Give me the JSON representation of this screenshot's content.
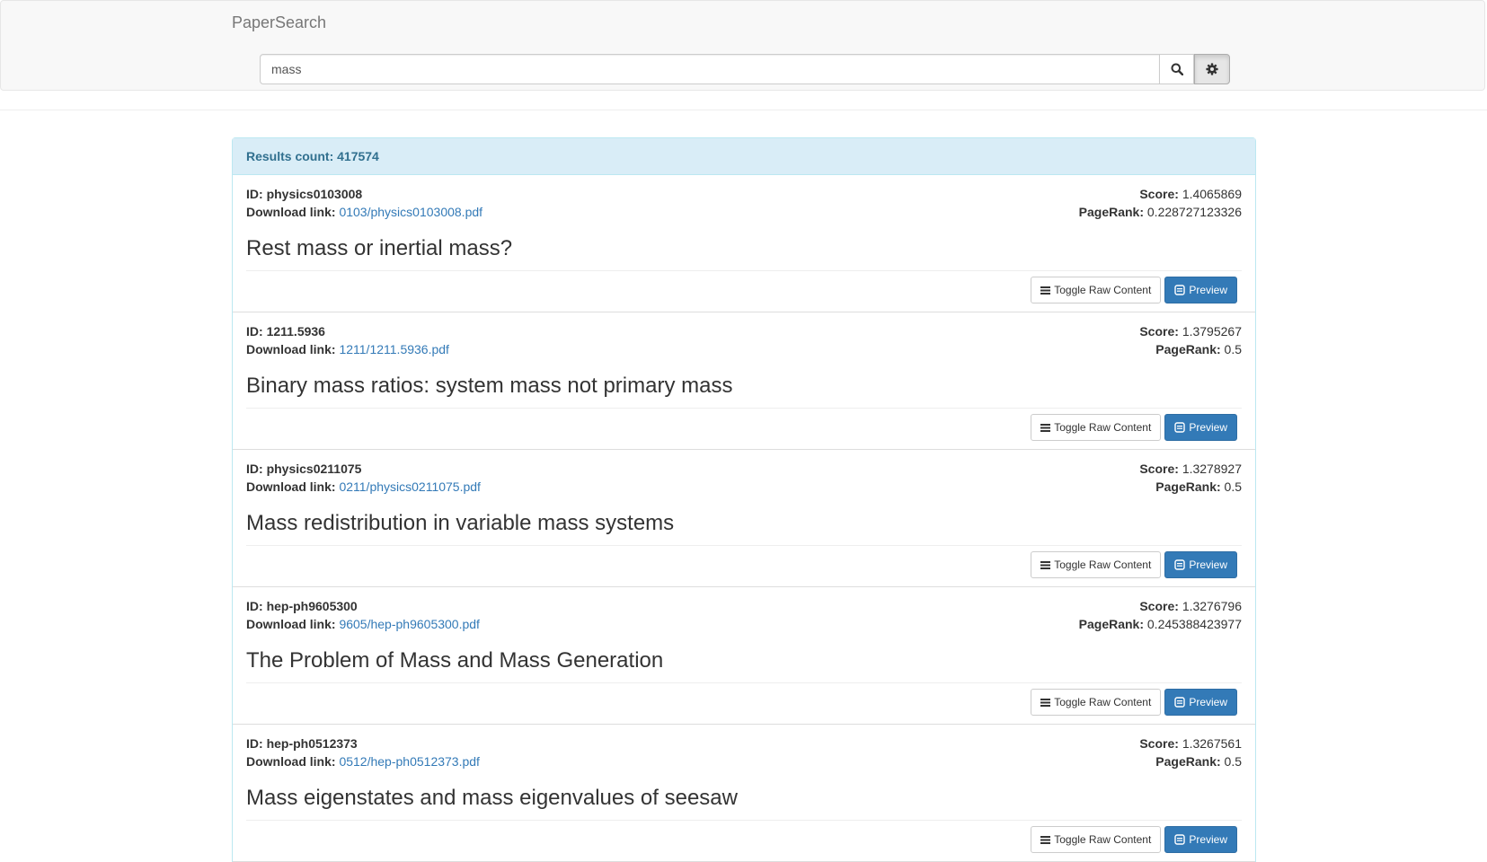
{
  "app": {
    "brand": "PaperSearch"
  },
  "search": {
    "query": "mass",
    "search_icon": "search-icon",
    "settings_icon": "gear-icon"
  },
  "results": {
    "count_label": "Results count: 417574",
    "labels": {
      "id": "ID:",
      "download": "Download link:",
      "score": "Score:",
      "pagerank": "PageRank:",
      "toggle": "Toggle Raw Content",
      "preview": "Preview"
    },
    "items": [
      {
        "id": "physics0103008",
        "download": "0103/physics0103008.pdf",
        "score": "1.4065869",
        "pagerank": "0.228727123326",
        "title": "Rest mass or inertial mass?"
      },
      {
        "id": "1211.5936",
        "download": "1211/1211.5936.pdf",
        "score": "1.3795267",
        "pagerank": "0.5",
        "title": "Binary mass ratios: system mass not primary mass"
      },
      {
        "id": "physics0211075",
        "download": "0211/physics0211075.pdf",
        "score": "1.3278927",
        "pagerank": "0.5",
        "title": "Mass redistribution in variable mass systems"
      },
      {
        "id": "hep-ph9605300",
        "download": "9605/hep-ph9605300.pdf",
        "score": "1.3276796",
        "pagerank": "0.245388423977",
        "title": "The Problem of Mass and Mass Generation"
      },
      {
        "id": "hep-ph0512373",
        "download": "0512/hep-ph0512373.pdf",
        "score": "1.3267561",
        "pagerank": "0.5",
        "title": "Mass eigenstates and mass eigenvalues of seesaw"
      }
    ]
  }
}
